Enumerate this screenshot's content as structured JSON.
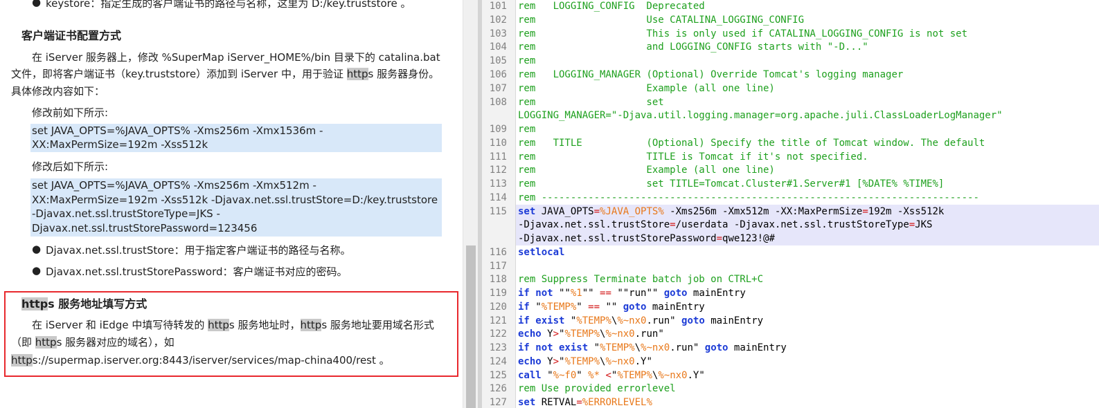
{
  "doc": {
    "top_bullet": "keystore：指定生成的客户端证书的路径与名称，这里为 D:/key.truststore 。",
    "section1_title": "客户端证书配置方式",
    "para1": {
      "l1": "在 iServer 服务器上，修改 %SuperMap iServer_HOME%/bin 目录下的 catalina.bat",
      "l2a": "文件，即将客户端证书（key.truststore）添加到 iServer 中，用于验证 ",
      "l2hl": "http",
      "l2b": "s 服务器身份。",
      "l3": "具体修改内容如下："
    },
    "before_label": "修改前如下所示:",
    "before_code": [
      "set JAVA_OPTS=%JAVA_OPTS% -Xms256m -Xmx1536m -",
      "XX:MaxPermSize=192m -Xss512k"
    ],
    "after_label": "修改后如下所示:",
    "after_code": [
      " set JAVA_OPTS=%JAVA_OPTS% -Xms256m -Xmx512m -",
      "XX:MaxPermSize=192m -Xss512k -Djavax.net.ssl.trustStore=D:/key.truststore",
      "-Djavax.net.ssl.trustStoreType=JKS -",
      "Djavax.net.ssl.trustStorePassword=123456"
    ],
    "bullets": [
      "Djavax.net.ssl.trustStore：用于指定客户端证书的路径与名称。",
      "Djavax.net.ssl.trustStorePassword：客户端证书对应的密码。"
    ],
    "section2": {
      "title_hl": "http",
      "title_rest": "s 服务地址填写方式",
      "l1a": "在 iServer 和 iEdge 中填写待转发的 ",
      "l1hl1": "http",
      "l1b": "s 服务地址时，",
      "l1hl2": "http",
      "l1c": "s 服务地址要用域名形式",
      "l2a": "（即 ",
      "l2hl": "http",
      "l2b": "s 服务器对应的域名），如",
      "l3hl": "http",
      "l3b": "s://supermap.iserver.org:8443/iserver/services/map-china400/rest 。"
    }
  },
  "editor": {
    "line_numbers": [
      "101",
      "102",
      "103",
      "104",
      "105",
      "106",
      "107",
      "108",
      "",
      "109",
      "110",
      "111",
      "112",
      "113",
      "114",
      "115",
      "",
      "",
      "116",
      "117",
      "118",
      "119",
      "120",
      "121",
      "122",
      "123",
      "124",
      "125",
      "126",
      "127"
    ],
    "lines": {
      "l101": "rem   LOGGING_CONFIG  Deprecated",
      "l102": "rem                   Use CATALINA_LOGGING_CONFIG",
      "l103": "rem                   This is only used if CATALINA_LOGGING_CONFIG is not set",
      "l104": "rem                   and LOGGING_CONFIG starts with \"-D...\"",
      "l105": "rem",
      "l106": "rem   LOGGING_MANAGER (Optional) Override Tomcat's logging manager",
      "l107": "rem                   Example (all one line)",
      "l108": "rem                   set",
      "l108b": "LOGGING_MANAGER=\"-Djava.util.logging.manager=org.apache.juli.ClassLoaderLogManager\"",
      "l109": "rem",
      "l110": "rem   TITLE           (Optional) Specify the title of Tomcat window. The default",
      "l111": "rem                   TITLE is Tomcat if it's not specified.",
      "l112": "rem                   Example (all one line)",
      "l113": "rem                   set TITLE=Tomcat.Cluster#1.Server#1 [%DATE% %TIME%]",
      "l114": "rem ---------------------------------------------------------------------------",
      "l117": "",
      "l118": "rem Suppress Terminate batch job on CTRL+C",
      "l126": "rem Use provided errorlevel"
    }
  },
  "colors": {
    "comment": "#1ea01e",
    "keyword": "#1c3bd6",
    "variable": "#e8781a",
    "operator": "#d21414",
    "selection": "#e6e6fa",
    "doc_code_bg": "#d8e8f9",
    "red_box": "#e8282d"
  }
}
